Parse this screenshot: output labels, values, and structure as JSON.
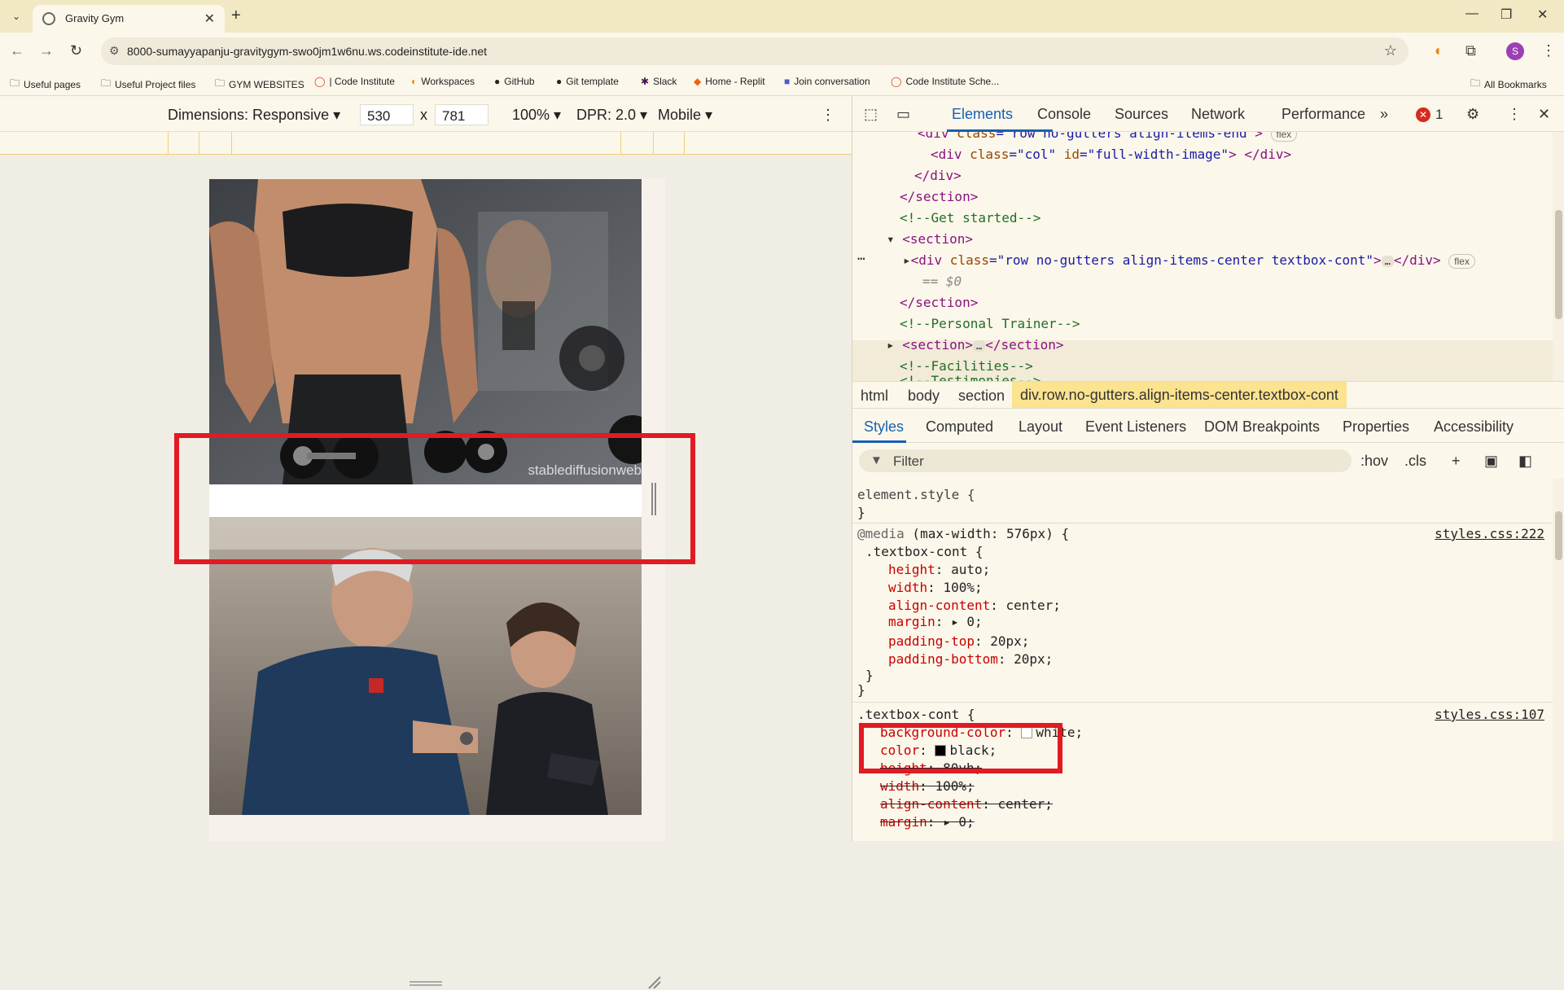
{
  "browser": {
    "tab_title": "Gravity Gym",
    "url": "8000-sumayyapanju-gravitygym-swo0jm1w6nu.ws.codeinstitute-ide.net",
    "profile_initial": "S",
    "bookmarks": [
      "Useful pages",
      "Useful Project files",
      "GYM WEBSITES",
      "| Code Institute",
      "Workspaces",
      "GitHub",
      "Git template",
      "Slack",
      "Home - Replit",
      "Join conversation",
      "Code Institute Sche..."
    ],
    "all_bookmarks": "All Bookmarks"
  },
  "device_toolbar": {
    "dimensions": "Dimensions: Responsive",
    "width": "530",
    "times": "x",
    "height": "781",
    "zoom": "100%",
    "dpr": "DPR: 2.0",
    "mode": "Mobile"
  },
  "viewport": {
    "watermark": "stablediffusionweb"
  },
  "devtools": {
    "tabs": [
      "Elements",
      "Console",
      "Sources",
      "Network",
      "Performance"
    ],
    "error_count": "1",
    "dom_lines": {
      "l0_tag_open": "<div",
      "l0_attr": " class",
      "l0_val": "=\"row no-gutters align-items-end\"",
      "l0_close": ">",
      "l1_tag": "<div",
      "l1_attr1": " class",
      "l1_val1": "=\"col\"",
      "l1_attr2": " id",
      "l1_val2": "=\"full-width-image\"",
      "l1_end": "> </div>",
      "l2": "</div>",
      "l3": "</section>",
      "l4": "<!--Get started-->",
      "l5": "<section>",
      "l6_tag": "<div",
      "l6_attr": " class",
      "l6_val": "=\"row no-gutters align-items-center textbox-cont\"",
      "l6_mid": ">",
      "l6_end": "</div>",
      "l6_eq": "== $0",
      "l7": "</section>",
      "l8": "<!--Personal Trainer-->",
      "l9_open": "<section>",
      "l9_close": "</section>",
      "l10": "<!--Facilities-->",
      "l11": "<!--Testimonies-->",
      "flex_badge": "flex",
      "ellipsis": "…"
    },
    "breadcrumbs": [
      "html",
      "body",
      "section"
    ],
    "breadcrumb_selected": "div.row.no-gutters.align-items-center.textbox-cont",
    "subtabs": [
      "Styles",
      "Computed",
      "Layout",
      "Event Listeners",
      "DOM Breakpoints",
      "Properties",
      "Accessibility"
    ],
    "filter_placeholder": "Filter",
    "filter_tools": [
      ":hov",
      ".cls"
    ],
    "styles": {
      "element_style": "element.style {",
      "close_brace": "}",
      "media_at": "@media",
      "media_query": " (max-width: 576px) {",
      "media_src": "styles.css:222",
      "sel1": ".textbox-cont {",
      "rule1": [
        {
          "p": "height",
          "v": "auto;"
        },
        {
          "p": "width",
          "v": "100%;"
        },
        {
          "p": "align-content",
          "v": "center;"
        },
        {
          "p": "margin",
          "v": "0;"
        },
        {
          "p": "padding-top",
          "v": "20px;"
        },
        {
          "p": "padding-bottom",
          "v": "20px;"
        }
      ],
      "sel2": ".textbox-cont {",
      "src2": "styles.css:107",
      "rule2": [
        {
          "p": "background-color",
          "v": "white;"
        },
        {
          "p": "color",
          "v": "black;"
        },
        {
          "p": "height",
          "v": "80vh;"
        },
        {
          "p": "width",
          "v": "100%;"
        },
        {
          "p": "align-content",
          "v": "center;"
        },
        {
          "p": "margin",
          "v": "0;"
        }
      ]
    }
  },
  "colors": {
    "accent": "#1a5fb4",
    "highlight_red": "#e01b24",
    "breadcrumb_selected_bg": "#fbe38f"
  }
}
